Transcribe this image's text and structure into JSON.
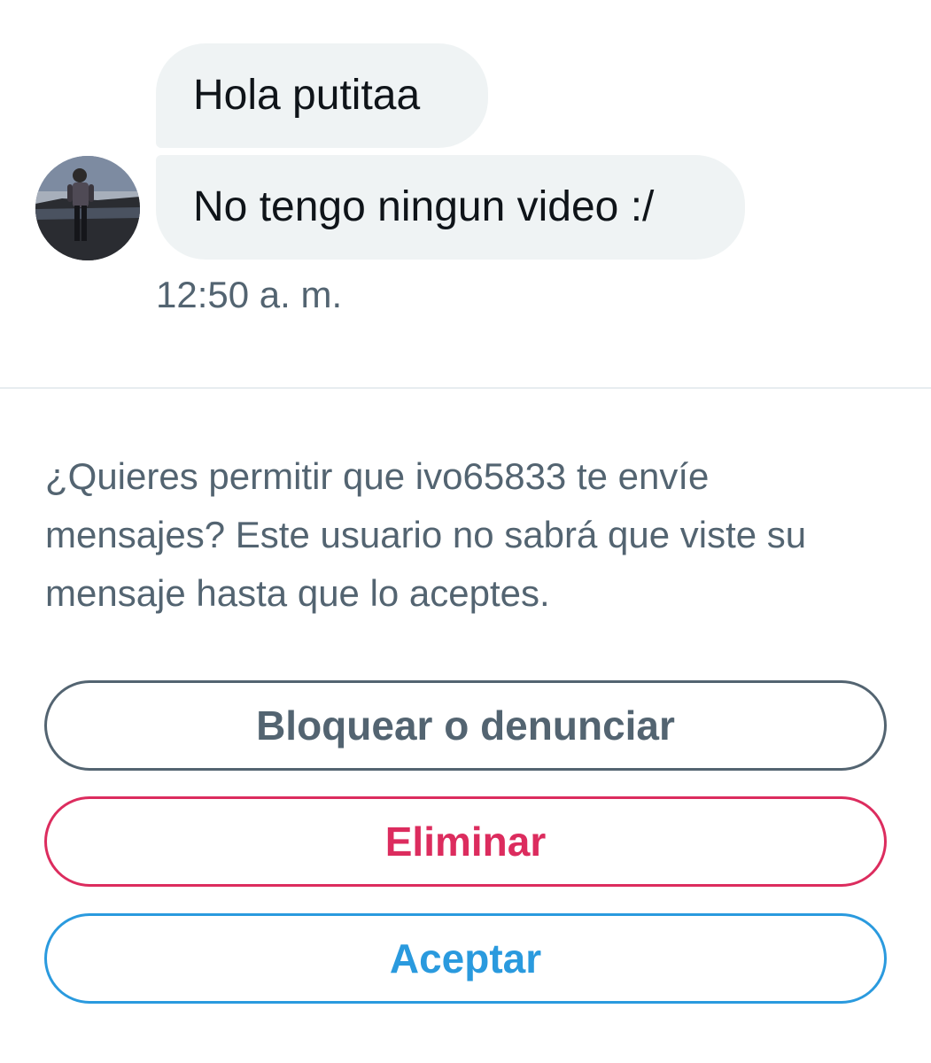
{
  "conversation": {
    "avatar_icon": "user-avatar-photo",
    "messages": [
      {
        "text": "Hola putitaa"
      },
      {
        "text": "No tengo ningun video :/"
      }
    ],
    "timestamp": "12:50 a. m."
  },
  "request": {
    "prompt": "¿Quieres permitir que ivo65833 te envíe mensajes? Este usuario no sabrá que viste su mensaje hasta que lo aceptes."
  },
  "actions": {
    "block_report_label": "Bloquear o denunciar",
    "delete_label": "Eliminar",
    "accept_label": "Aceptar"
  },
  "colors": {
    "bubble_bg": "#eff3f4",
    "secondary_text": "#536471",
    "delete": "#dc2c5e",
    "accept": "#2a9ade"
  }
}
